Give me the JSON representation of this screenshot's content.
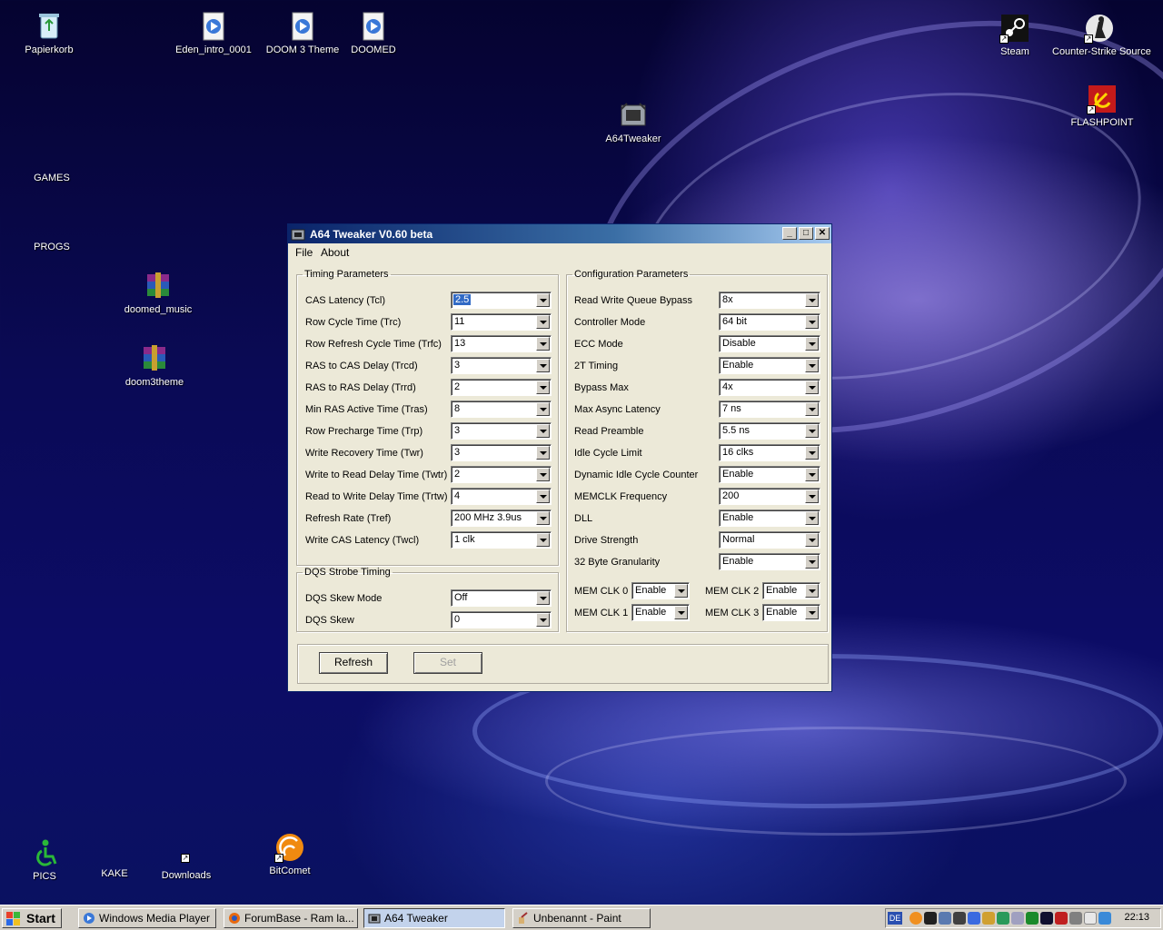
{
  "desktop": {
    "icons": [
      {
        "id": "papierkorb",
        "label": "Papierkorb",
        "icon": "recycle-bin-icon"
      },
      {
        "id": "eden",
        "label": "Eden_intro_0001",
        "icon": "media-file-icon"
      },
      {
        "id": "doom3theme",
        "label": "DOOM 3 Theme",
        "icon": "media-file-icon"
      },
      {
        "id": "doomed",
        "label": "DOOMED",
        "icon": "media-file-icon"
      },
      {
        "id": "steam",
        "label": "Steam",
        "icon": "steam-icon"
      },
      {
        "id": "css",
        "label": "Counter-Strike Source",
        "icon": "counter-strike-icon"
      },
      {
        "id": "flashpoint",
        "label": "FLASHPOINT",
        "icon": "flashpoint-icon"
      },
      {
        "id": "a64tweaker",
        "label": "A64Tweaker",
        "icon": "a64tweaker-icon"
      },
      {
        "id": "games",
        "label": "GAMES",
        "icon": ""
      },
      {
        "id": "progs",
        "label": "PROGS",
        "icon": ""
      },
      {
        "id": "doomed_music",
        "label": "doomed_music",
        "icon": "winrar-archive-icon"
      },
      {
        "id": "doom3theme_rar",
        "label": "doom3theme",
        "icon": "winrar-archive-icon"
      },
      {
        "id": "pics",
        "label": "PICS",
        "icon": "accessibility-icon"
      },
      {
        "id": "kake",
        "label": "KAKE",
        "icon": ""
      },
      {
        "id": "downloads",
        "label": "Downloads",
        "icon": "shortcut-icon"
      },
      {
        "id": "bitcomet",
        "label": "BitComet",
        "icon": "bitcomet-icon"
      }
    ]
  },
  "window": {
    "title": "A64 Tweaker V0.60 beta",
    "menu": [
      "File",
      "About"
    ],
    "timing": {
      "legend": "Timing Parameters",
      "rows": [
        {
          "label": "CAS Latency (Tcl)",
          "value": "2.5"
        },
        {
          "label": "Row Cycle Time (Trc)",
          "value": "11"
        },
        {
          "label": "Row Refresh Cycle Time (Trfc)",
          "value": "13"
        },
        {
          "label": "RAS to CAS Delay (Trcd)",
          "value": "3"
        },
        {
          "label": "RAS to RAS Delay (Trrd)",
          "value": "2"
        },
        {
          "label": "Min RAS Active Time (Tras)",
          "value": "8"
        },
        {
          "label": "Row Precharge Time (Trp)",
          "value": "3"
        },
        {
          "label": "Write Recovery Time (Twr)",
          "value": "3"
        },
        {
          "label": "Write to Read Delay Time (Twtr)",
          "value": "2"
        },
        {
          "label": "Read to Write Delay Time (Trtw)",
          "value": "4"
        },
        {
          "label": "Refresh Rate (Tref)",
          "value": "200 MHz 3.9us"
        },
        {
          "label": "Write CAS Latency (Twcl)",
          "value": "1 clk"
        }
      ]
    },
    "dqs": {
      "legend": "DQS Strobe Timing",
      "rows": [
        {
          "label": "DQS Skew Mode",
          "value": "Off"
        },
        {
          "label": "DQS Skew",
          "value": "0"
        }
      ]
    },
    "config": {
      "legend": "Configuration Parameters",
      "rows": [
        {
          "label": "Read Write Queue Bypass",
          "value": "8x"
        },
        {
          "label": "Controller Mode",
          "value": "64 bit"
        },
        {
          "label": "ECC Mode",
          "value": "Disable"
        },
        {
          "label": "2T Timing",
          "value": "Enable"
        },
        {
          "label": "Bypass Max",
          "value": "4x"
        },
        {
          "label": "Max Async Latency",
          "value": "7 ns"
        },
        {
          "label": "Read Preamble",
          "value": "5.5 ns"
        },
        {
          "label": "Idle Cycle Limit",
          "value": "16 clks"
        },
        {
          "label": "Dynamic Idle Cycle Counter",
          "value": "Enable"
        },
        {
          "label": "MEMCLK Frequency",
          "value": "200"
        },
        {
          "label": "DLL",
          "value": "Enable"
        },
        {
          "label": "Drive Strength",
          "value": "Normal"
        },
        {
          "label": "32 Byte Granularity",
          "value": "Enable"
        }
      ],
      "memclk": [
        {
          "label": "MEM CLK 0",
          "value": "Enable"
        },
        {
          "label": "MEM CLK 2",
          "value": "Enable"
        },
        {
          "label": "MEM CLK 1",
          "value": "Enable"
        },
        {
          "label": "MEM CLK 3",
          "value": "Enable"
        }
      ]
    },
    "buttons": {
      "refresh": "Refresh",
      "set": "Set"
    }
  },
  "taskbar": {
    "start": "Start",
    "tasks": [
      {
        "label": "Windows Media Player",
        "active": false
      },
      {
        "label": "ForumBase - Ram la...",
        "active": false
      },
      {
        "label": "A64 Tweaker",
        "active": true
      },
      {
        "label": "Unbenannt - Paint",
        "active": false
      }
    ],
    "language": "DE",
    "clock": "22:13"
  }
}
